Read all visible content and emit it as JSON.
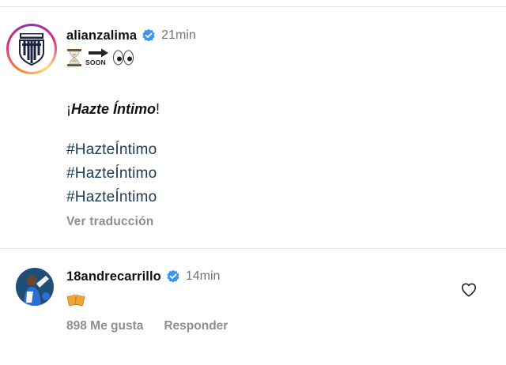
{
  "post": {
    "username": "alianzalima",
    "timestamp": "21min",
    "emoji_row": {
      "hourglass": "hourglass-icon",
      "arrow": "arrow-right-icon",
      "soon_text": "SOON",
      "eyes": "eyes-icon"
    },
    "tagline_prefix": "¡",
    "tagline_bold": "Hazte Íntimo",
    "tagline_suffix": "!",
    "hashtags": [
      "#HazteÍntimo",
      "#HazteÍntimo",
      "#HazteÍntimo"
    ],
    "translate_label": "Ver traducción"
  },
  "comment": {
    "username": "18andrecarrillo",
    "timestamp": "14min",
    "emoji": "beer-mugs-icon",
    "likes_label": "898 Me gusta",
    "reply_label": "Responder"
  },
  "colors": {
    "verified_blue": "#3897f0",
    "hashtag": "#1a3a57",
    "muted": "#8e8e8e",
    "story_ring": [
      "#f58529",
      "#dd2a7b",
      "#8134af",
      "#feda77"
    ]
  }
}
